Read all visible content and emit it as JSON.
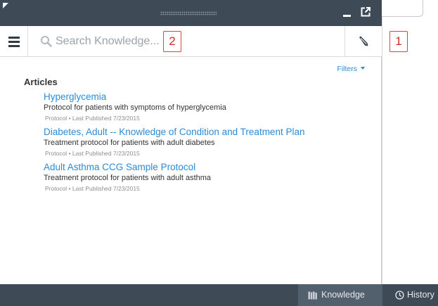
{
  "toolbar": {
    "search_placeholder": "Search Knowledge...",
    "menu_icon": "hamburger-icon",
    "search_icon": "search-icon",
    "compose_icon": "pencil-icon"
  },
  "window": {
    "minimize_icon": "minimize-icon",
    "popout_icon": "popout-icon"
  },
  "callouts": {
    "first": "1",
    "second": "2"
  },
  "filters_label": "Filters",
  "section_title": "Articles",
  "articles": [
    {
      "title": "Hyperglycemia",
      "description": "Protocol for patients with symptoms of hyperglycemia",
      "meta": "Protocol • Last Published 7/23/2015"
    },
    {
      "title": "Diabetes, Adult -- Knowledge of Condition and Treatment Plan",
      "description": "Treatment protocol for patients with adult diabetes",
      "meta": "Protocol • Last Published 7/23/2015"
    },
    {
      "title": "Adult Asthma CCG Sample Protocol",
      "description": "Treatment protocol for patients with adult asthma",
      "meta": "Protocol • Last Published 7/23/2015"
    }
  ],
  "bottom_tabs": {
    "knowledge": "Knowledge",
    "history": "History"
  },
  "colors": {
    "titlebar": "#3f4a57",
    "link": "#2b8bd8",
    "callout": "#e0433a",
    "active_tab": "#525f6d"
  }
}
